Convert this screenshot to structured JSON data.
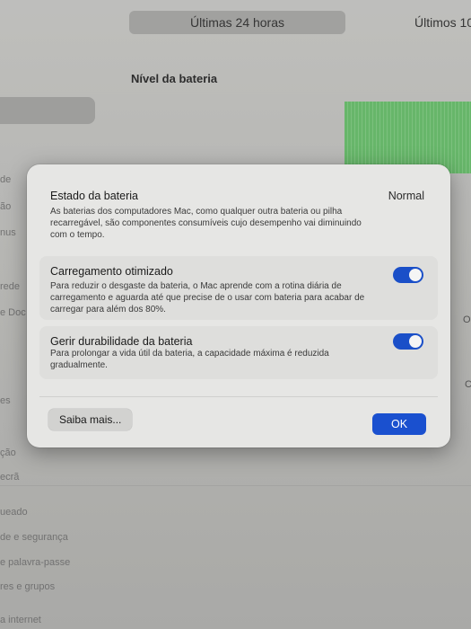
{
  "background": {
    "segments": {
      "left": "Últimas 24 horas",
      "right": "Últimos 10"
    },
    "title": "Nível da bateria",
    "sidebar_fragments": [
      "de",
      "ão",
      "nus",
      "rede",
      "e Doc",
      "es",
      "ção",
      "ecrã",
      "ueado",
      "de e segurança",
      "e palavra-passe",
      "res e grupos",
      "a internet"
    ],
    "right_fragments": [
      "O",
      "C"
    ]
  },
  "dialog": {
    "battery_state": {
      "title": "Estado da bateria",
      "status": "Normal",
      "description": "As baterias dos computadores Mac, como qualquer outra bateria ou pilha recarregável, são componentes consumíveis cujo desempenho vai diminuindo com o tempo."
    },
    "optimized_charging": {
      "title": "Carregamento otimizado",
      "description": "Para reduzir o desgaste da bateria, o Mac aprende com a rotina diária de carregamento e aguarda até que precise de o usar com bateria para acabar de carregar para além dos 80%.",
      "enabled": true
    },
    "health_management": {
      "title": "Gerir durabilidade da bateria",
      "description": "Para prolongar a vida útil da bateria, a capacidade máxima é reduzida gradualmente.",
      "enabled": true
    },
    "learn_more_label": "Saiba mais...",
    "ok_label": "OK"
  },
  "colors": {
    "accent": "#1a50cf",
    "chart_green": "#6cc56f"
  }
}
